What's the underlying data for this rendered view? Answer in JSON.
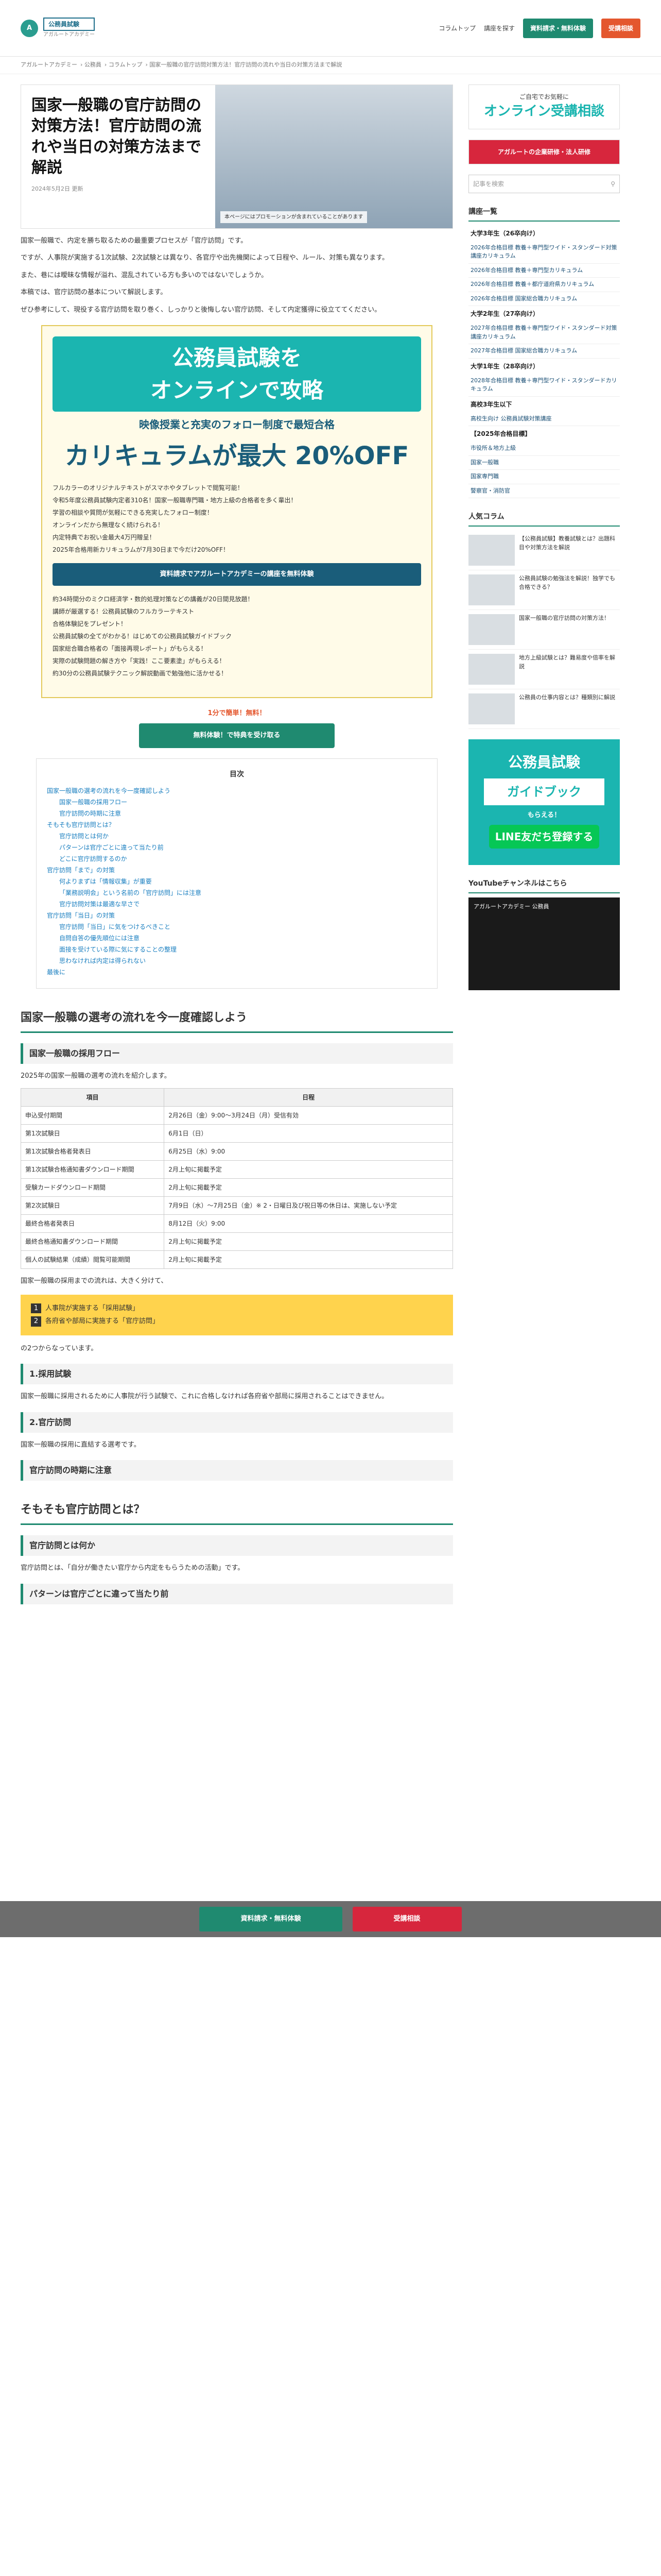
{
  "header": {
    "logo_main": "公務員試験",
    "logo_sub": "アガルートアカデミー",
    "logo_tag": "公務員試験対策講座",
    "nav": [
      "コラムトップ",
      "講座を探す"
    ],
    "cta_brochure": "資料請求・無料体験",
    "cta_consult": "受講相談"
  },
  "breadcrumb": [
    "アガルートアカデミー",
    "公務員",
    "コラムトップ",
    "国家一般職の官庁訪問対策方法！官庁訪問の流れや当日の対策方法まで解説"
  ],
  "article": {
    "title": "国家一般職の官庁訪問の対策方法！官庁訪問の流れや当日の対策方法まで解説",
    "date": "2024年5月2日 更新",
    "img_caption": "本ページにはプロモーションが含まれていることがあります",
    "intro": [
      "国家一般職で、内定を勝ち取るための最重要プロセスが「官庁訪問」です。",
      "ですが、人事院が実施する1次試験、2次試験とは異なり、各官庁や出先機関によって日程や、ルール、対策も異なります。",
      "また、巷には曖昧な情報が溢れ、混乱されている方も多いのではないでしょうか。",
      "本稿では、官庁訪問の基本について解説します。",
      "ぜひ参考にして、現役する官庁訪問を取り巻く、しっかりと後悔しない官庁訪問、そして内定獲得に役立ててください。"
    ],
    "banner": {
      "line1": "公務員試験を",
      "line2": "オンラインで攻略",
      "sub": "映像授業と充実のフォロー制度で最短合格",
      "discount": "カリキュラムが最大 20%OFF",
      "bullets": [
        "フルカラーのオリジナルテキストがスマホやタブレットで閲覧可能！",
        "令和5年度公務員試験内定者310名！国家一般職専門職・地方上級の合格者を多く輩出！",
        "学習の相談や質問が気軽にできる充実したフォロー制度！",
        "オンラインだから無理なく続けられる！",
        "内定特典でお祝い金最大4万円贈呈！",
        "2025年合格用新カリキュラムが7月30日まで今だけ20%OFF！"
      ],
      "panel_title": "資料請求でアガルートアカデミーの講座を無料体験",
      "panel_items": [
        "約34時間分のミクロ経済学・数的処理対策などの講義が20日間見放題！",
        "講師が厳選する！公務員試験のフルカラーテキスト",
        "合格体験記をプレゼント！",
        "公務員試験の全てがわかる！はじめての公務員試験ガイドブック",
        "国家総合職合格者の「面接再現レポート」がもらえる！",
        "実際の試験問題の解き方や「実践！ここ要素塗」がもらえる！",
        "約30分の公務員試験テクニック解説動画で勉強他に活かせる！"
      ],
      "free_label": "1分で簡単！無料！",
      "cta": "無料体験！で特典を受け取る"
    }
  },
  "toc": {
    "title": "目次",
    "items": [
      {
        "label": "国家一般職の選考の流れを今一度確認しよう",
        "level": 1
      },
      {
        "label": "国家一般職の採用フロー",
        "level": 2
      },
      {
        "label": "官庁訪問の時期に注意",
        "level": 2
      },
      {
        "label": "そもそも官庁訪問とは？",
        "level": 1
      },
      {
        "label": "官庁訪問とは何か",
        "level": 2
      },
      {
        "label": "パターンは官庁ごとに違って当たり前",
        "level": 2
      },
      {
        "label": "どこに官庁訪問するのか",
        "level": 2
      },
      {
        "label": "官庁訪問「まで」の対策",
        "level": 1
      },
      {
        "label": "何よりまずは「情報収集」が重要",
        "level": 2
      },
      {
        "label": "「業務説明会」という名前の「官庁訪問」には注意",
        "level": 2
      },
      {
        "label": "官庁訪問対策は最適な早さで",
        "level": 2
      },
      {
        "label": "官庁訪問「当日」の対策",
        "level": 1
      },
      {
        "label": "官庁訪問「当日」に気をつけるべきこと",
        "level": 2
      },
      {
        "label": "自問自答の優先順位には注意",
        "level": 2
      },
      {
        "label": "面接を受けている際に気にすることの整理",
        "level": 2
      },
      {
        "label": "思わなければ内定は得られない",
        "level": 2
      },
      {
        "label": "最後に",
        "level": 1
      }
    ]
  },
  "sec1": {
    "title": "国家一般職の選考の流れを今一度確認しよう",
    "sub1": "国家一般職の採用フロー",
    "lead": "2025年の国家一般職の選考の流れを紹介します。",
    "table_head": [
      "項目",
      "日程"
    ],
    "table_rows": [
      [
        "申込受付期間",
        "2月26日（金）9:00～3月24日（月）受信有効"
      ],
      [
        "第1次試験日",
        "6月1日（日）"
      ],
      [
        "第1次試験合格者発表日",
        "6月25日（水）9:00"
      ],
      [
        "第1次試験合格通知書ダウンロード期間",
        "2月上旬に掲載予定"
      ],
      [
        "受験カードダウンロード期間",
        "2月上旬に掲載予定"
      ],
      [
        "第2次試験日",
        "7月9日（水）～7月25日（金）※ 2・日曜日及び祝日等の休日は、実施しない予定"
      ],
      [
        "最終合格者発表日",
        "8月12日（火）9:00"
      ],
      [
        "最終合格通知書ダウンロード期間",
        "2月上旬に掲載予定"
      ],
      [
        "個人の試験結果（成績）閲覧可能期間",
        "2月上旬に掲載予定"
      ]
    ],
    "after": "国家一般職の採用までの流れは、大きく分けて、",
    "steps": [
      "人事院が実施する「採用試験」",
      "各府省や部局に実施する「官庁訪問」"
    ],
    "after2": "の2つからなっています。",
    "h1": "1.採用試験",
    "p1": "国家一般職に採用されるために人事院が行う試験で、これに合格しなければ各府省や部局に採用されることはできません。",
    "h2": "2.官庁訪問",
    "p2": "国家一般職の採用に直結する選考です。",
    "sub2": "官庁訪問の時期に注意"
  },
  "sec2": {
    "title": "そもそも官庁訪問とは？",
    "sub1": "官庁訪問とは何か",
    "p1": "官庁訪問とは、「自分が働きたい官庁から内定をもらうための活動」です。",
    "sub2": "パターンは官庁ごとに違って当たり前"
  },
  "floatbar": {
    "btn1": "資料請求・無料体験",
    "btn2": "受講相談"
  },
  "side": {
    "ad_top": "ご自宅でお気軽に",
    "ad_title": "オンライン受講相談",
    "ad_sub": "アガルートの企業研修・法人研修",
    "search_placeholder": "記事を検索",
    "course_head": "講座一覧",
    "course_groups": [
      {
        "cat": "大学3年生（26卒向け）",
        "items": [
          "2026年合格目標 教養＋専門型ワイド・スタンダード対策講座カリキュラム",
          "2026年合格目標 教養＋専門型カリキュラム",
          "2026年合格目標 教養＋都庁道府県カリキュラム",
          "2026年合格目標 国家総合職カリキュラム"
        ]
      },
      {
        "cat": "大学2年生（27卒向け）",
        "items": [
          "2027年合格目標 教養＋専門型ワイド・スタンダード対策講座カリキュラム",
          "2027年合格目標 国家総合職カリキュラム"
        ]
      },
      {
        "cat": "大学1年生（28卒向け）",
        "items": [
          "2028年合格目標 教養＋専門型ワイド・スタンダードカリキュラム"
        ]
      },
      {
        "cat": "高校3年生以下",
        "items": [
          "高校生向け 公務員試験対策講座"
        ]
      },
      {
        "cat": "【2025年合格目標】",
        "items": [
          "市役所＆地方上級",
          "国家一般職",
          "国家専門職",
          "警察官・消防官"
        ]
      }
    ],
    "popular_head": "人気コラム",
    "popular": [
      "【公務員試験】教養試験とは？出題科目や対策方法を解説",
      "公務員試験の勉強法を解説！独学でも合格できる？",
      "国家一般職の官庁訪問の対策方法！",
      "地方上級試験とは？難易度や倍率を解説",
      "公務員の仕事内容とは？種類別に解説"
    ],
    "guide": {
      "line1": "公務員試験",
      "line2": "ガイドブック",
      "line3": "もらえる！",
      "line4": "LINE友だち登録する"
    },
    "yt_head": "YouTubeチャンネルはこちら",
    "yt_title": "アガルートアカデミー 公務員"
  }
}
